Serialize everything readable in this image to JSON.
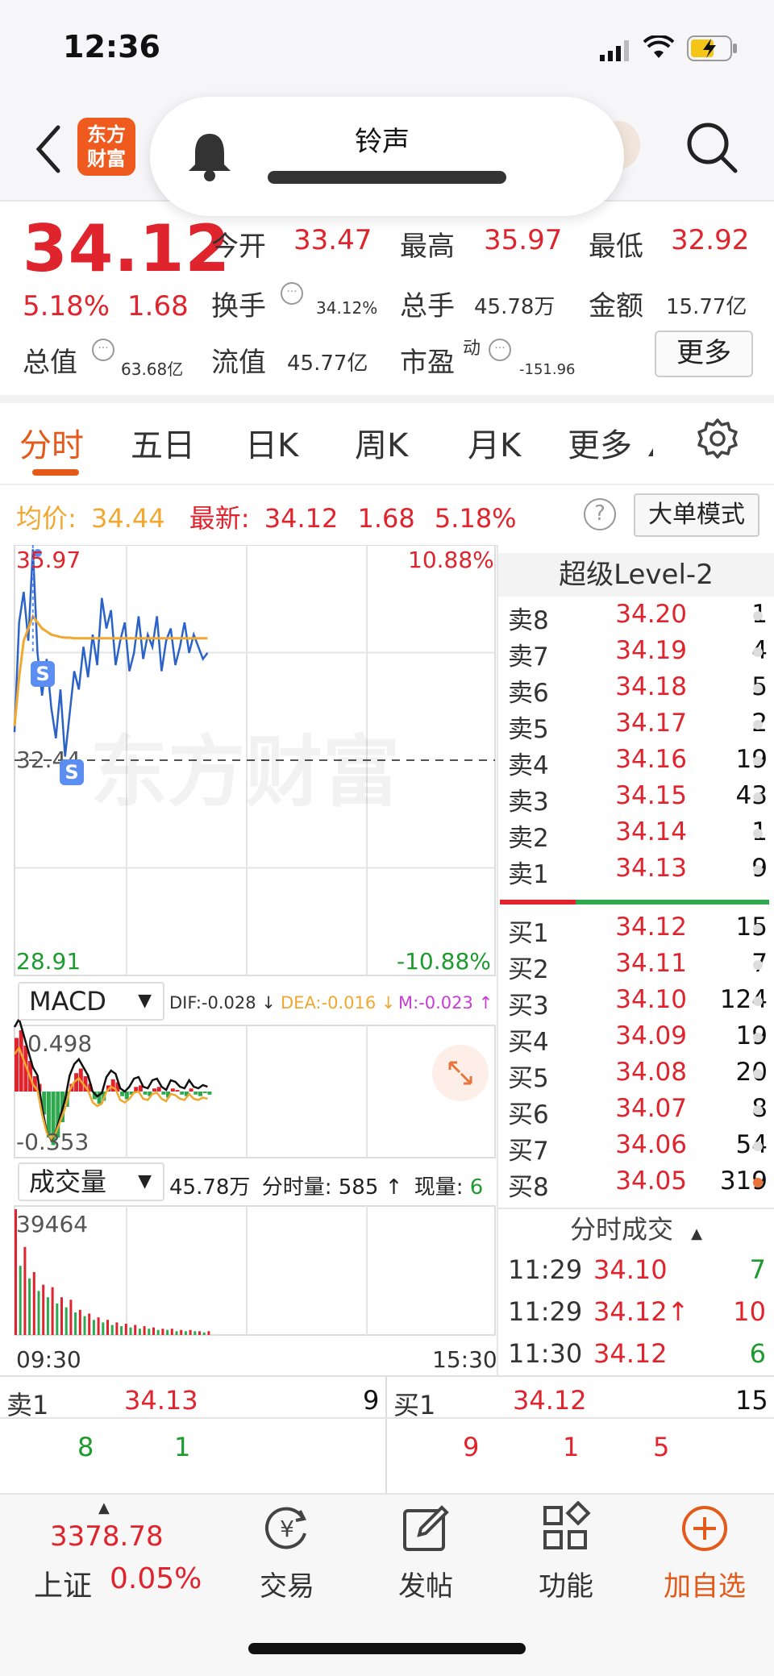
{
  "status": {
    "time": "12:36"
  },
  "nav": {
    "logo_line1": "东方",
    "logo_line2": "财富",
    "ringtone_label": "铃声"
  },
  "quote": {
    "price": "34.12",
    "change_pct": "5.18%",
    "change": "1.68",
    "open_label": "今开",
    "open": "33.47",
    "high_label": "最高",
    "high": "35.97",
    "low_label": "最低",
    "low": "32.92",
    "turnover_label": "换手",
    "turnover": "34.12%",
    "volume_label": "总手",
    "volume": "45.78万",
    "amount_label": "金额",
    "amount": "15.77亿",
    "mktcap_label": "总值",
    "mktcap": "63.68亿",
    "float_label": "流值",
    "float_cap": "45.77亿",
    "pe_label": "市盈",
    "pe_sup": "动",
    "pe": "-151.96",
    "more_label": "更多"
  },
  "tabs": [
    {
      "label": "分时"
    },
    {
      "label": "五日"
    },
    {
      "label": "日K"
    },
    {
      "label": "周K"
    },
    {
      "label": "月K"
    },
    {
      "label": "更多"
    }
  ],
  "avg_row": {
    "avg_label": "均价:",
    "avg": "34.44",
    "latest_label": "最新:",
    "latest": "34.12",
    "change": "1.68",
    "change_pct": "5.18%",
    "help_icon": "question-icon",
    "big_order_label": "大单模式"
  },
  "chart": {
    "price_high": "35.97",
    "price_pre_close": "32.44",
    "price_low": "28.91",
    "pct_high": "10.88%",
    "pct_low": "-10.88%",
    "marker_label": "S",
    "watermark": "东方财富",
    "time_start": "09:30",
    "time_end": "15:30"
  },
  "chart_data": {
    "type": "line",
    "title": "",
    "ylim": [
      28.91,
      35.97
    ],
    "pre_close": 32.44,
    "series": [
      {
        "name": "",
        "color": "#2a62c8",
        "values": [
          32.9,
          34.7,
          35.2,
          34.4,
          35.9,
          34.2,
          33.5,
          34.1,
          33.3,
          32.8,
          33.6,
          32.5,
          33.2,
          33.9,
          33.6,
          34.3,
          33.8,
          34.5,
          34.0,
          35.1,
          34.6,
          34.9,
          34.0,
          34.4,
          34.7,
          33.9,
          34.2,
          34.8,
          34.1,
          34.5,
          34.3,
          34.8,
          33.9,
          34.4,
          34.6,
          34.0,
          34.3,
          34.7,
          34.2,
          34.5,
          34.3,
          34.1,
          34.2
        ]
      },
      {
        "name": "均价",
        "color": "#f0a830",
        "values": [
          33.0,
          33.8,
          34.4,
          34.6,
          34.8,
          34.7,
          34.6,
          34.55,
          34.5,
          34.48,
          34.46,
          34.45,
          34.45,
          34.44,
          34.44,
          34.44,
          34.44,
          34.44,
          34.44,
          34.44,
          34.44,
          34.44,
          34.44,
          34.44,
          34.44,
          34.44,
          34.44,
          34.44,
          34.44,
          34.44,
          34.44,
          34.44,
          34.44,
          34.44,
          34.44,
          34.44,
          34.44,
          34.44,
          34.44,
          34.44,
          34.44,
          34.44,
          34.44
        ]
      }
    ],
    "macd": {
      "select_label": "MACD",
      "dif": "DIF:-0.028 ↓",
      "dea": "DEA:-0.016 ↓",
      "m": "M:-0.023 ↑",
      "ymax_label": "0.498",
      "ymin_label": "-0.353",
      "bars": [
        0.35,
        0.4,
        0.3,
        0.2,
        0.1,
        0.05,
        -0.15,
        -0.3,
        -0.35,
        -0.3,
        -0.2,
        -0.1,
        0.05,
        0.12,
        0.15,
        0.1,
        0.05,
        -0.05,
        -0.08,
        -0.06,
        0.04,
        0.08,
        0.06,
        -0.03,
        -0.05,
        -0.02,
        0.03,
        0.04,
        -0.02,
        -0.03,
        0.02,
        0.03,
        -0.02,
        -0.04,
        0.02,
        0.01,
        -0.02,
        -0.03,
        0.02,
        -0.02,
        -0.03,
        -0.01,
        -0.02
      ]
    },
    "volume": {
      "select_label": "成交量",
      "info_total": "45.78万",
      "info_tick_label": "分时量:",
      "info_tick": "585 ↑",
      "info_now_label": "现量:",
      "info_now": "6",
      "ymax_label": "39464",
      "bars": [
        1.0,
        0.55,
        0.7,
        0.45,
        0.5,
        0.35,
        0.4,
        0.3,
        0.38,
        0.25,
        0.3,
        0.22,
        0.28,
        0.18,
        0.2,
        0.15,
        0.17,
        0.12,
        0.14,
        0.1,
        0.12,
        0.08,
        0.1,
        0.07,
        0.09,
        0.06,
        0.08,
        0.05,
        0.07,
        0.05,
        0.06,
        0.04,
        0.05,
        0.04,
        0.05,
        0.03,
        0.04,
        0.03,
        0.04,
        0.03,
        0.03,
        0.02,
        0.03
      ]
    }
  },
  "level2": {
    "title": "超级Level-2",
    "asks": [
      {
        "side": "卖8",
        "price": "34.20",
        "vol": "1"
      },
      {
        "side": "卖7",
        "price": "34.19",
        "vol": "4"
      },
      {
        "side": "卖6",
        "price": "34.18",
        "vol": "5"
      },
      {
        "side": "卖5",
        "price": "34.17",
        "vol": "2"
      },
      {
        "side": "卖4",
        "price": "34.16",
        "vol": "19"
      },
      {
        "side": "卖3",
        "price": "34.15",
        "vol": "43"
      },
      {
        "side": "卖2",
        "price": "34.14",
        "vol": "1"
      },
      {
        "side": "卖1",
        "price": "34.13",
        "vol": "9"
      }
    ],
    "bids": [
      {
        "side": "买1",
        "price": "34.12",
        "vol": "15"
      },
      {
        "side": "买2",
        "price": "34.11",
        "vol": "7"
      },
      {
        "side": "买3",
        "price": "34.10",
        "vol": "124"
      },
      {
        "side": "买4",
        "price": "34.09",
        "vol": "19"
      },
      {
        "side": "买5",
        "price": "34.08",
        "vol": "20"
      },
      {
        "side": "买6",
        "price": "34.07",
        "vol": "8"
      },
      {
        "side": "买7",
        "price": "34.06",
        "vol": "54"
      },
      {
        "side": "买8",
        "price": "34.05",
        "vol": "319"
      }
    ]
  },
  "ticks": {
    "title": "分时成交",
    "rows": [
      {
        "time": "11:29",
        "price": "34.10",
        "vol": "7",
        "color": "green"
      },
      {
        "time": "11:29",
        "price": "34.12↑",
        "vol": "10",
        "color": "red"
      },
      {
        "time": "11:30",
        "price": "34.12",
        "vol": "6",
        "color": "green"
      }
    ]
  },
  "queue": {
    "sell_label": "卖1",
    "sell_price": "34.13",
    "sell_vol": "9",
    "sell_items": [
      "8",
      "1"
    ],
    "buy_label": "买1",
    "buy_price": "34.12",
    "buy_vol": "15",
    "buy_items": [
      "9",
      "1",
      "5"
    ]
  },
  "bottom_nav": {
    "index_value": "3378.78",
    "index_name": "上证",
    "index_pct": "0.05%",
    "items": [
      {
        "label": "交易",
        "icon": "yuan-cycle-icon"
      },
      {
        "label": "发帖",
        "icon": "edit-icon"
      },
      {
        "label": "功能",
        "icon": "grid-icon"
      },
      {
        "label": "加自选",
        "icon": "plus-circle-icon"
      }
    ]
  }
}
